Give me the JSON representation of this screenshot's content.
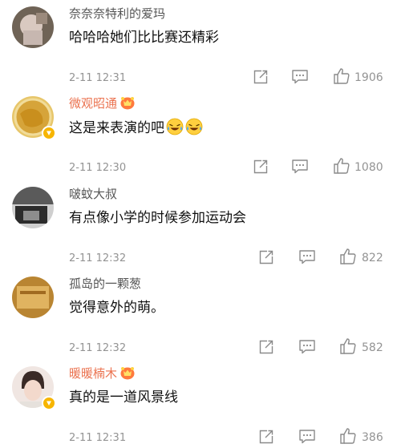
{
  "comments": [
    {
      "username": "奈奈奈特利的爱玛",
      "text": "哈哈哈她们比比赛还精彩",
      "time": "2-11 12:31",
      "likes": "1906",
      "vip": false,
      "badge": false,
      "emojis": 0,
      "avatar_color": "#8a7a6a"
    },
    {
      "username": "微观昭通",
      "text": "这是来表演的吧",
      "time": "2-11 12:30",
      "likes": "1080",
      "vip": true,
      "badge": true,
      "emojis": 2,
      "avatar_color": "#d8a83a"
    },
    {
      "username": "啵蚊大叔",
      "text": "有点像小学的时候参加运动会",
      "time": "2-11 12:32",
      "likes": "822",
      "vip": false,
      "badge": false,
      "emojis": 0,
      "avatar_color": "#3c3c3c"
    },
    {
      "username": "孤岛的一颗葱",
      "text": "觉得意外的萌。",
      "time": "2-11 12:32",
      "likes": "582",
      "vip": false,
      "badge": false,
      "emojis": 0,
      "avatar_color": "#c9953c"
    },
    {
      "username": "暖暖楠木",
      "text": "真的是一道风景线",
      "time": "2-11 12:31",
      "likes": "386",
      "vip": true,
      "badge": true,
      "emojis": 0,
      "avatar_color": "#e8d6cc"
    }
  ],
  "icons": {
    "share": "share-icon",
    "comment": "comment-icon",
    "like": "thumbs-up-icon",
    "emoji": "laughing-tears-emoji",
    "crown": "vip-crown-icon",
    "badge": "verified-badge-icon"
  },
  "colors": {
    "vip_name": "#eb7350",
    "name": "#555555",
    "meta": "#939393",
    "badge": "#f7b500"
  }
}
